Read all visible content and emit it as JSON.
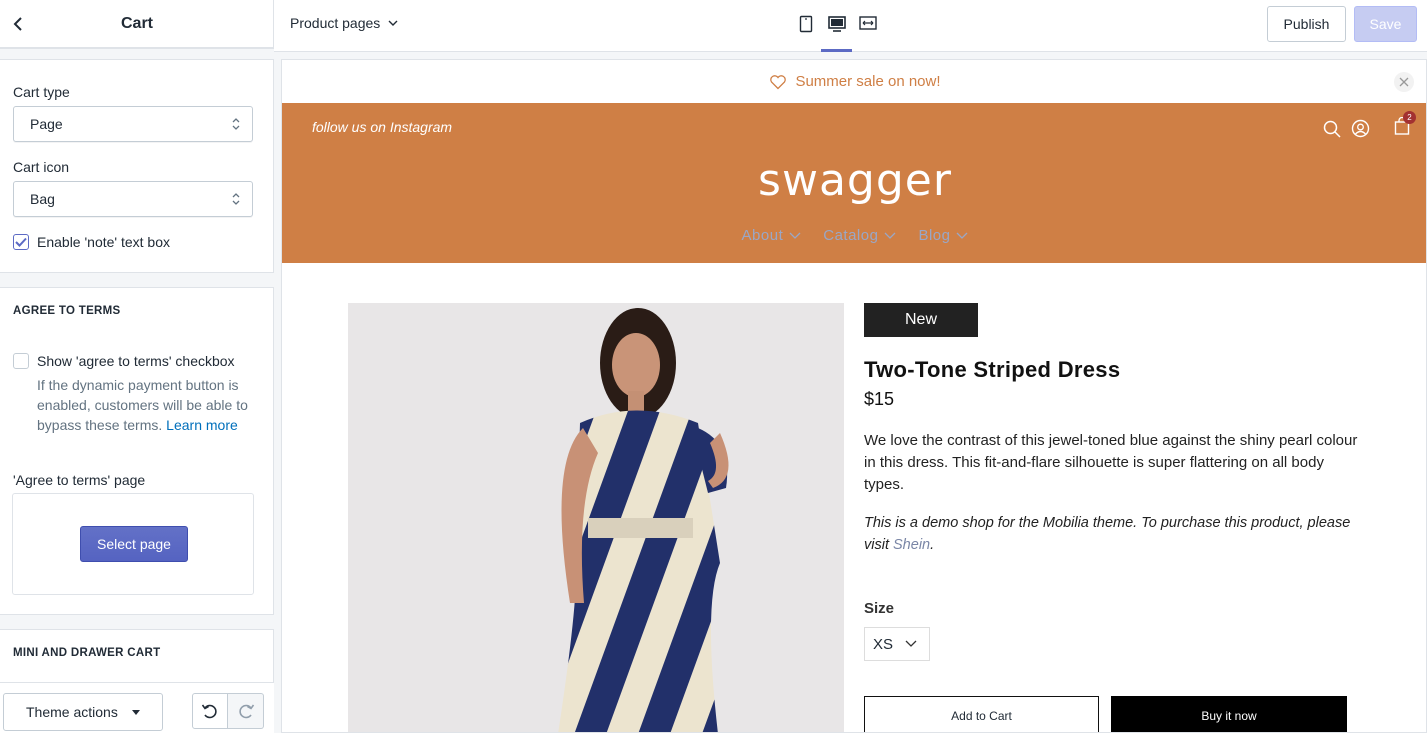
{
  "sidebar": {
    "title": "Cart",
    "cart_type": {
      "label": "Cart type",
      "value": "Page"
    },
    "cart_icon": {
      "label": "Cart icon",
      "value": "Bag"
    },
    "note_checkbox": {
      "label": "Enable 'note' text box",
      "checked": true
    },
    "agree_section": {
      "title": "AGREE TO TERMS",
      "checkbox_label": "Show 'agree to terms' checkbox",
      "checked": false,
      "help_text": "If the dynamic payment button is enabled, customers will be able to bypass these terms.",
      "help_link": "Learn more",
      "page_label": "'Agree to terms' page",
      "select_button": "Select page"
    },
    "mini_section": {
      "title": "MINI AND DRAWER CART"
    },
    "footer": {
      "theme_actions": "Theme actions"
    }
  },
  "topbar": {
    "page_selector": "Product pages",
    "publish": "Publish",
    "save": "Save"
  },
  "preview": {
    "announcement": "Summer sale on now!",
    "follow": "follow us on Instagram",
    "cart_count": "2",
    "logo": "swagger",
    "nav": [
      {
        "label": "About"
      },
      {
        "label": "Catalog"
      },
      {
        "label": "Blog"
      }
    ],
    "product": {
      "badge": "New",
      "title": "Two-Tone Striped Dress",
      "price": "$15",
      "description": "We love the contrast of this jewel-toned blue against the shiny pearl colour in this dress. This fit-and-flare silhouette is super flattering on all body types.",
      "note_prefix": "This is a demo shop for the Mobilia theme. To purchase this product, please visit",
      "note_link": "Shein",
      "note_suffix": ".",
      "size_label": "Size",
      "size_value": "XS",
      "add_to_cart": "Add to Cart",
      "buy_now": "Buy it now"
    }
  },
  "colors": {
    "accent": "#5c6ac4",
    "header_bg": "#cf7f45",
    "announcement_text": "#cf7f45"
  }
}
